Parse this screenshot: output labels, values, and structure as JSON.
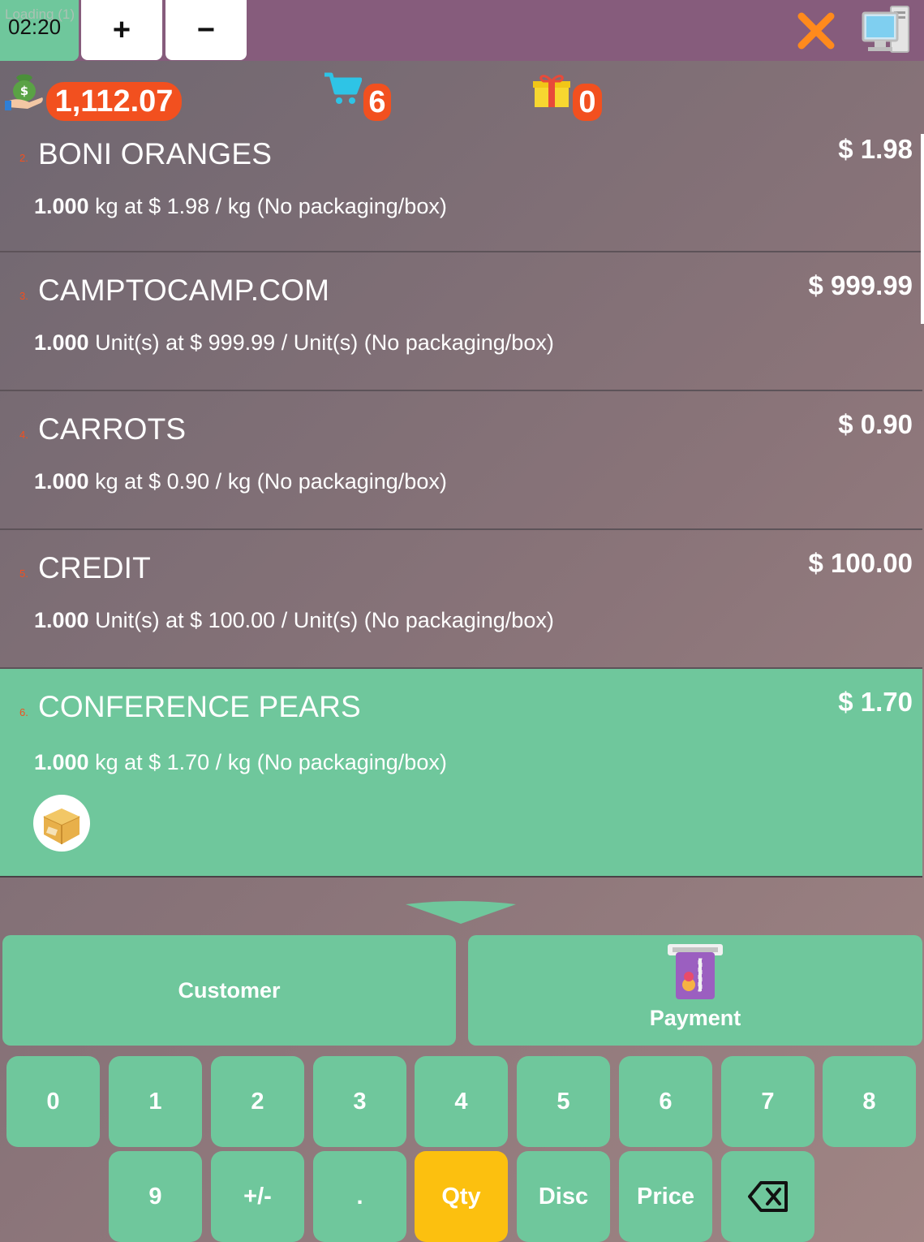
{
  "topbar": {
    "loading_text": "Loading (1)",
    "clock": "02:20",
    "plus_label": "+",
    "minus_label": "−",
    "close_icon": "close-icon",
    "monitor_icon": "monitor-icon"
  },
  "summary": {
    "total_amount": "1,112.07",
    "cart_count": "6",
    "gift_count": "0"
  },
  "orderlines": [
    {
      "index": "2.",
      "name": "BONI ORANGES",
      "price": "$ 1.98",
      "qty": "1.000",
      "detail": " kg at $ 1.98 / kg (No packaging/box)"
    },
    {
      "index": "3.",
      "name": "CAMPTOCAMP.COM",
      "price": "$ 999.99",
      "qty": "1.000",
      "detail": " Unit(s) at $ 999.99 / Unit(s) (No packaging/box)"
    },
    {
      "index": "4.",
      "name": "CARROTS",
      "price": "$ 0.90",
      "qty": "1.000",
      "detail": " kg at $ 0.90 / kg (No packaging/box)"
    },
    {
      "index": "5.",
      "name": "CREDIT",
      "price": "$ 100.00",
      "qty": "1.000",
      "detail": " Unit(s) at $ 100.00 / Unit(s) (No packaging/box)"
    },
    {
      "index": "6.",
      "name": "CONFERENCE PEARS",
      "price": "$ 1.70",
      "qty": "1.000",
      "detail": " kg at $ 1.70 / kg (No packaging/box)",
      "selected": true
    }
  ],
  "actions": {
    "customer_label": "Customer",
    "payment_label": "Payment"
  },
  "numpad": {
    "k0": "0",
    "k1": "1",
    "k2": "2",
    "k3": "3",
    "k4": "4",
    "k5": "5",
    "k6": "6",
    "k7": "7",
    "k8": "8",
    "k9": "9",
    "plusminus": "+/-",
    "dot": ".",
    "qty": "Qty",
    "disc": "Disc",
    "price": "Price",
    "backspace_icon": "backspace-icon",
    "active_mode": "Qty"
  },
  "colors": {
    "topbar": "#865c7c",
    "accent_green": "#6fc79c",
    "badge_orange": "#f2501f",
    "active_yellow": "#fcc00f"
  }
}
